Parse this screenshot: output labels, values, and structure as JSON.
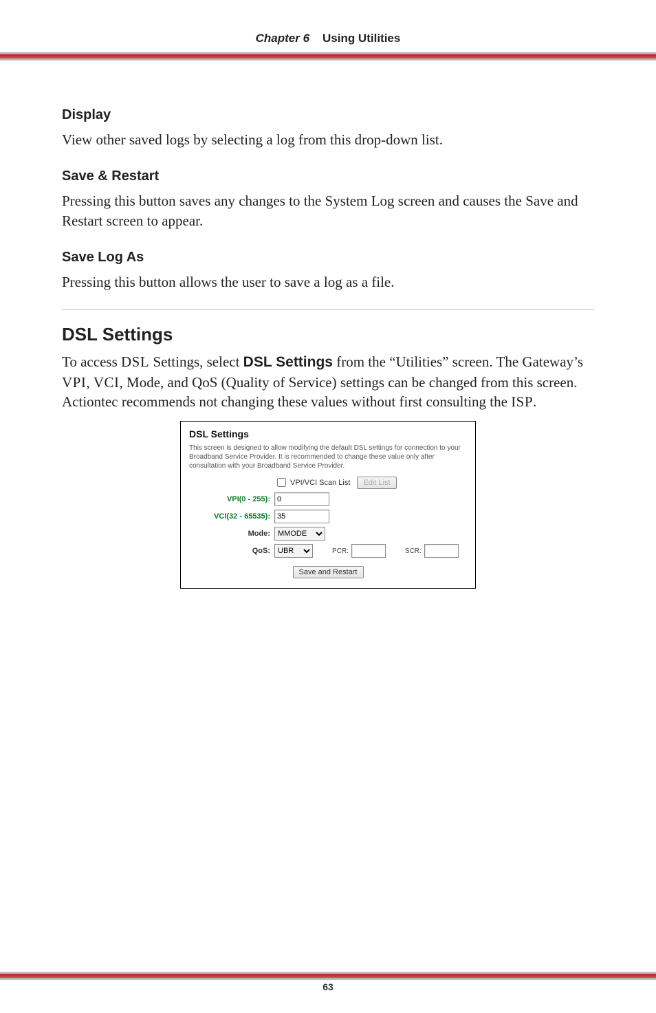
{
  "header": {
    "chapter": "Chapter 6",
    "title": "Using Utilities"
  },
  "sections": {
    "display": {
      "heading": "Display",
      "body": "View other saved logs by selecting a log from this drop-down list."
    },
    "save_restart": {
      "heading": "Save & Restart",
      "body": "Pressing this button saves any changes to the System Log screen and causes the Save and Restart screen to appear."
    },
    "save_log_as": {
      "heading": "Save Log As",
      "body": "Pressing this button allows the user to save a log as a file."
    },
    "dsl_settings": {
      "heading": "DSL Settings",
      "body_pre": "To access ",
      "body_sc1": "DSL",
      "body_mid1": " Settings, select ",
      "body_bold": "DSL Settings",
      "body_mid2": " from the “Utilities” screen. The Gateway’s ",
      "body_sc2": "VPI",
      "body_mid3": ", ",
      "body_sc3": "VCI",
      "body_mid4": ", Mode, and QoS (Quality of Service) settings can be changed from this screen. Actiontec recommends not changing these values without first consulting the ",
      "body_sc4": "ISP",
      "body_end": "."
    }
  },
  "panel": {
    "title": "DSL Settings",
    "desc": "This screen is designed to allow modifying the default DSL settings for connection to your Broadband Service Provider. It is recommended to change these value only after consultation with your Broadband Service Provider.",
    "scanlist_label": "VPI/VCI Scan List",
    "editlist_btn": "Edit List",
    "vpi_label": "VPI(0 - 255):",
    "vpi_value": "0",
    "vci_label": "VCI(32 - 65535):",
    "vci_value": "35",
    "mode_label": "Mode:",
    "mode_value": "MMODE",
    "qos_label": "QoS:",
    "qos_value": "UBR",
    "pcr_label": "PCR:",
    "pcr_value": "",
    "scr_label": "SCR:",
    "scr_value": "",
    "save_btn": "Save and Restart"
  },
  "footer": {
    "page": "63"
  }
}
